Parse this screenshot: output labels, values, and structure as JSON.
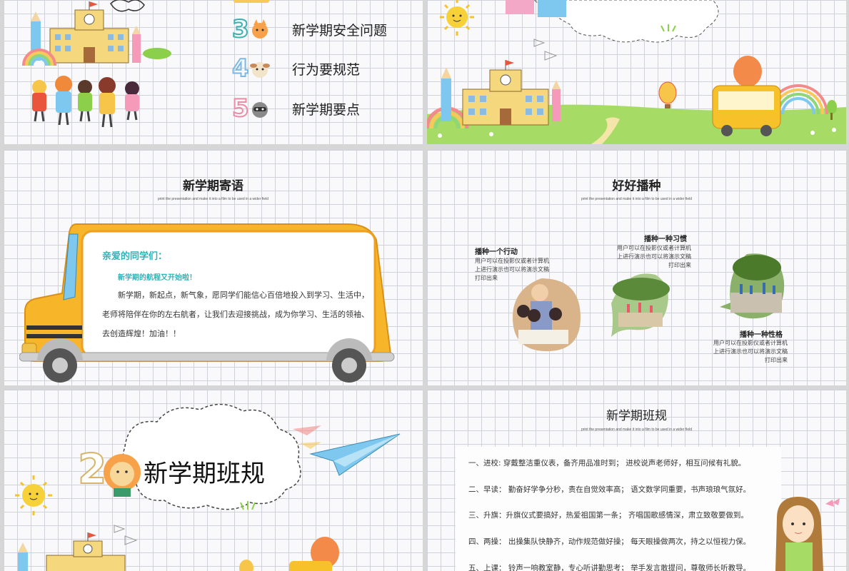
{
  "slide1": {
    "toc": [
      {
        "num": "3",
        "label": "新学期安全问题",
        "digit_color": "#3ab2b2"
      },
      {
        "num": "4",
        "label": "行为要规范",
        "digit_color": "#7ab8e6"
      },
      {
        "num": "5",
        "label": "新学期要点",
        "digit_color": "#f08aa6"
      }
    ]
  },
  "slide3": {
    "title": "新学期寄语",
    "subtitle": "print the presentation and make it into a film to be used in a wider field",
    "greeting": "亲爱的同学们：",
    "highlight": "新学期的航程又开始啦！",
    "lines": [
      "新学期，新起点，新气象，愿同学们能信心百倍地投入到学习、生活中，",
      "老师将陪伴在你的左右航者，让我们去迎接挑战，成为你学习、生活的领袖、",
      "去创造辉煌！加油！！"
    ]
  },
  "slide4": {
    "title": "好好播种",
    "subtitle": "print the presentation and make it into a film to be used in a wider field",
    "items": [
      {
        "title": "播种一个行动",
        "lines": [
          "用户可以在投影仪或者计算机",
          "上进行演示也可以将演示文稿",
          "打印出来"
        ]
      },
      {
        "title": "播种一种习惯",
        "lines": [
          "用户可以在投影仪或者计算机",
          "上进行演示也可以将演示文稿",
          "打印出来"
        ]
      },
      {
        "title": "播种一种性格",
        "lines": [
          "用户可以在投影仪或者计算机",
          "上进行演示也可以将演示文稿",
          "打印出来"
        ]
      }
    ]
  },
  "slide5": {
    "num": "2",
    "title": "新学期班规"
  },
  "slide6": {
    "title": "新学期班规",
    "subtitle": "print the presentation and make it into a film to be used in a wider field",
    "rules": [
      "一、进校: 穿戴整洁重仪表，备齐用品准时到；   进校说声老师好，相互问候有礼貌。",
      "二、早读：  勤奋好学争分秒，责在自觉效率高；   语文数学同重要，书声琅琅气氛好。",
      "三、升旗：升旗仪式要搞好，热爱祖国第一条；   齐唱国歌感情深，肃立致敬要做到。",
      "四、两操：  出操集队快静齐，动作规范做好操；   每天眼操做两次，持之以恒视力保。",
      "五、上课：  铃声一响教室静，专心听讲勤思考；   举手发言敢提问，尊敬师长听教导。"
    ]
  },
  "colors": {
    "teal": "#2fb3b8",
    "bus_yellow": "#f7b52a",
    "grass": "#8bcf4a"
  }
}
